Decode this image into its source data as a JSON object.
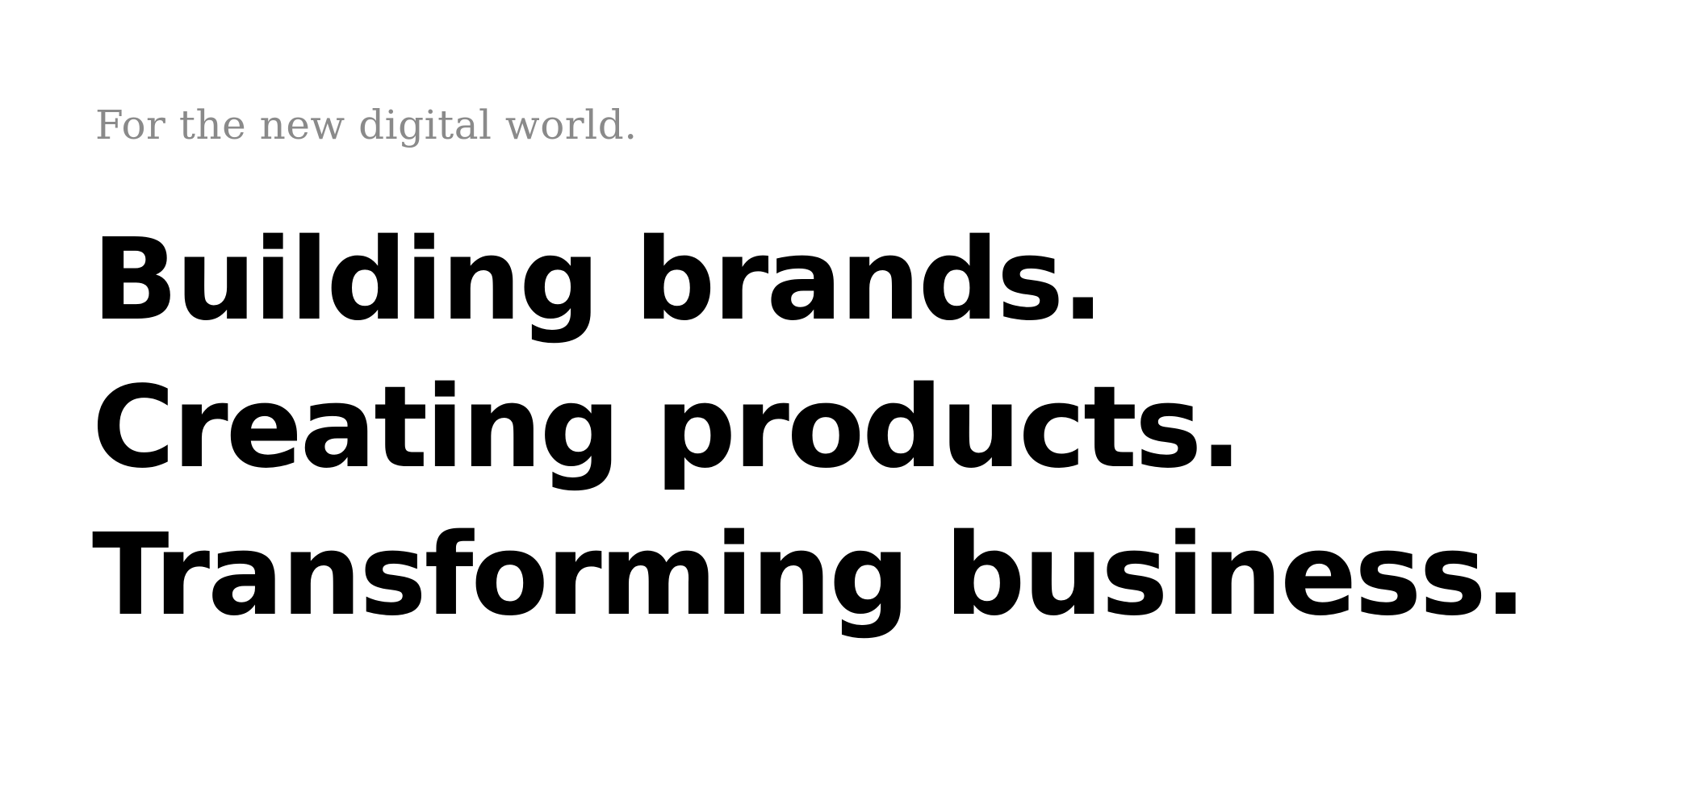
{
  "hero": {
    "tagline": "For the new digital world.",
    "lines": [
      "Building brands.",
      "Creating products.",
      "Transforming business."
    ]
  },
  "colors": {
    "background": "#ffffff",
    "tagline": "#8a8a8a",
    "headline": "#000000"
  }
}
